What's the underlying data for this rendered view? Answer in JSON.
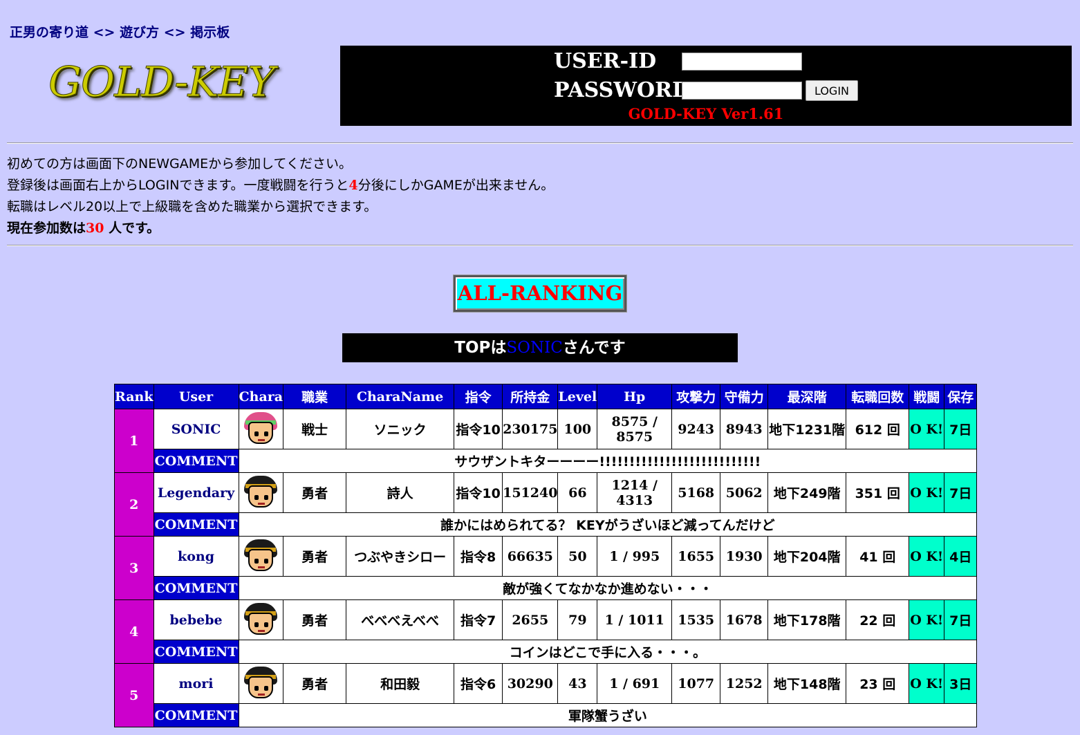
{
  "breadcrumb": {
    "home": "正男の寄り道",
    "sep1": "<>",
    "howto": "遊び方",
    "sep2": "<>",
    "board": "掲示板"
  },
  "logo": {
    "text": "GOLD-KEY"
  },
  "login": {
    "userid_label": "USER-ID",
    "password_label": "PASSWORD",
    "userid_value": "",
    "password_value": "",
    "button_label": "LOGIN",
    "version": "GOLD-KEY Ver1.61"
  },
  "notice": {
    "line1": "初めての方は画面下のNEWGAMEから参加してください。",
    "line2_pre": "登録後は画面右上からLOGINできます。一度戦闘を行うと",
    "line2_num": "4",
    "line2_post": "分後にしかGAMEが出来ません。",
    "line3": "転職はレベル20以上で上級職を含めた職業から選択できます。",
    "line4_pre": "現在参加数は",
    "line4_num": "30",
    "line4_post": " 人です。"
  },
  "all_ranking_label": "ALL-RANKING",
  "top_banner": {
    "pre": "TOPは",
    "name": "SONIC",
    "post": "さんです"
  },
  "table": {
    "headers": [
      "Rank",
      "User",
      "Chara",
      "職業",
      "CharaName",
      "指令",
      "所持金",
      "Level",
      "Hp",
      "攻撃力",
      "守備力",
      "最深階",
      "転職回数",
      "戦闘",
      "保存"
    ],
    "comment_label": "COMMENT",
    "rows": [
      {
        "rank": "1",
        "user": "SONIC",
        "avatar": "warrior-avatar",
        "job": "戦士",
        "chara_name": "ソニック",
        "order": "指令10",
        "money": "230175",
        "level": "100",
        "hp": "8575 / 8575",
        "atk": "9243",
        "def": "8943",
        "floor": "地下1231階",
        "job_changes": "612 回",
        "battle": "O K!",
        "save": "7日",
        "comment": "サウザントキターーーー!!!!!!!!!!!!!!!!!!!!!!!!!!!"
      },
      {
        "rank": "2",
        "user": "Legendary",
        "avatar": "hero-avatar",
        "job": "勇者",
        "chara_name": "詩人",
        "order": "指令10",
        "money": "151240",
        "level": "66",
        "hp": "1214 / 4313",
        "atk": "5168",
        "def": "5062",
        "floor": "地下249階",
        "job_changes": "351 回",
        "battle": "O K!",
        "save": "7日",
        "comment": "誰かにはめられてる？ KEYがうざいほど減ってんだけど"
      },
      {
        "rank": "3",
        "user": "kong",
        "avatar": "hero-avatar",
        "job": "勇者",
        "chara_name": "つぶやきシロー",
        "order": "指令8",
        "money": "66635",
        "level": "50",
        "hp": "1 / 995",
        "atk": "1655",
        "def": "1930",
        "floor": "地下204階",
        "job_changes": "41 回",
        "battle": "O K!",
        "save": "4日",
        "comment": "敵が強くてなかなか進めない・・・"
      },
      {
        "rank": "4",
        "user": "bebebe",
        "avatar": "hero-avatar",
        "job": "勇者",
        "chara_name": "べべべえべべ",
        "order": "指令7",
        "money": "2655",
        "level": "79",
        "hp": "1 / 1011",
        "atk": "1535",
        "def": "1678",
        "floor": "地下178階",
        "job_changes": "22 回",
        "battle": "O K!",
        "save": "7日",
        "comment": "コインはどこで手に入る・・・。"
      },
      {
        "rank": "5",
        "user": "mori",
        "avatar": "hero-avatar",
        "job": "勇者",
        "chara_name": "和田毅",
        "order": "指令6",
        "money": "30290",
        "level": "43",
        "hp": "1 / 691",
        "atk": "1077",
        "def": "1252",
        "floor": "地下148階",
        "job_changes": "23 回",
        "battle": "O K!",
        "save": "3日",
        "comment": "軍隊蟹うざい"
      }
    ]
  }
}
